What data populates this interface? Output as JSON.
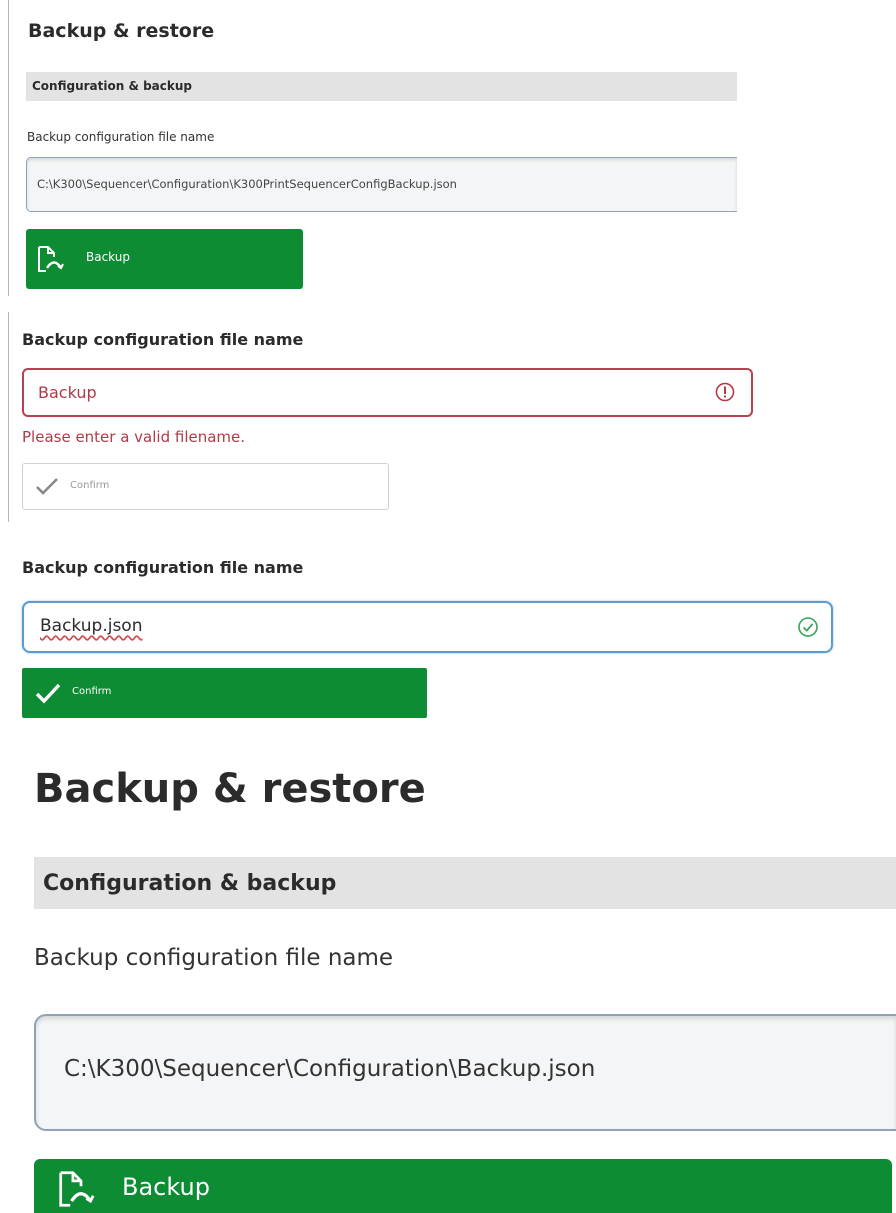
{
  "panel1": {
    "title": "Backup & restore",
    "section": "Configuration & backup",
    "field_label": "Backup configuration file name",
    "field_value": "C:\\K300\\Sequencer\\Configuration\\K300PrintSequencerConfigBackup.json",
    "button_label": "Backup",
    "button_icon": "backup-file-icon",
    "accent_color": "#0e8c34"
  },
  "panel2": {
    "field_label": "Backup configuration file name",
    "field_value": "Backup",
    "status_icon": "error-icon",
    "error_message": "Please enter a valid filename.",
    "button_label": "Confirm",
    "button_icon": "checkmark-icon",
    "button_state": "disabled",
    "error_color": "#b13a47"
  },
  "panel3": {
    "field_label": "Backup configuration file name",
    "field_value": "Backup.json",
    "status_icon": "valid-check-icon",
    "button_label": "Confirm",
    "button_icon": "checkmark-icon",
    "focus_color": "#5b9bd0",
    "accent_color": "#0e8c34"
  },
  "panel4": {
    "title": "Backup & restore",
    "section": "Configuration & backup",
    "field_label": "Backup configuration file name",
    "field_value": "C:\\K300\\Sequencer\\Configuration\\Backup.json",
    "button_label": "Backup",
    "button_icon": "backup-file-icon",
    "accent_color": "#0e8c34"
  }
}
